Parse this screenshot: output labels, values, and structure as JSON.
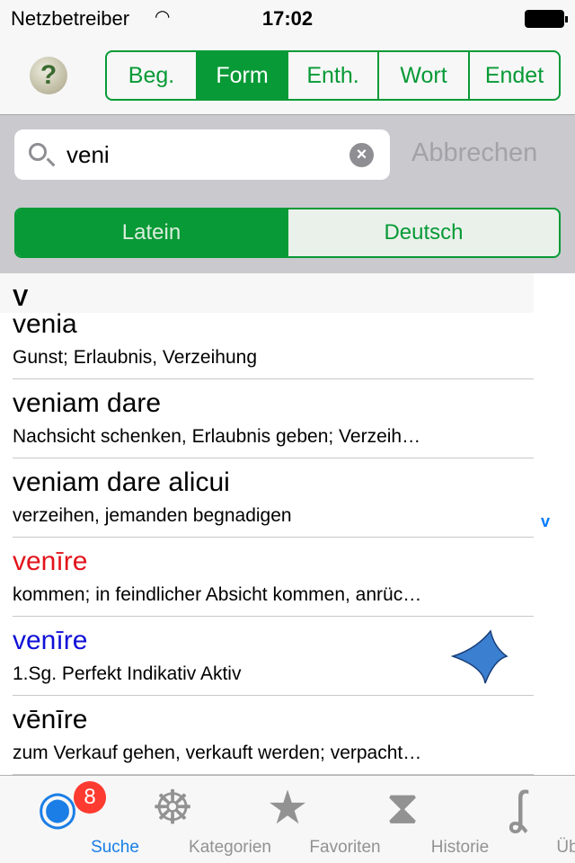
{
  "status": {
    "carrier": "Netzbetreiber",
    "time": "17:02"
  },
  "nav": {
    "help_label": "?",
    "modes": [
      {
        "label": "Beg.",
        "selected": false
      },
      {
        "label": "Form",
        "selected": true
      },
      {
        "label": "Enth.",
        "selected": false
      },
      {
        "label": "Wort",
        "selected": false
      },
      {
        "label": "Endet",
        "selected": false
      }
    ]
  },
  "search": {
    "value": "veni",
    "cancel_label": "Abbrechen"
  },
  "language": {
    "options": [
      "Latein",
      "Deutsch"
    ],
    "selected": "Latein"
  },
  "list": {
    "section": "V",
    "index_letter": "v",
    "rows": [
      {
        "title": "venia",
        "subtitle": "Gunst; Erlaubnis, Verzeihung",
        "color": "#000000"
      },
      {
        "title": "veniam dare",
        "subtitle": "Nachsicht schenken, Erlaubnis geben; Verzeih…",
        "color": "#000000"
      },
      {
        "title": "veniam dare alicui",
        "subtitle": "verzeihen, jemanden begnadigen",
        "color": "#000000"
      },
      {
        "title": "venīre",
        "subtitle": "kommen; in feindlicher Absicht kommen, anrüc…",
        "color": "#e3131b"
      },
      {
        "title": "venīre",
        "subtitle": "1.Sg. Perfekt Indikativ Aktiv",
        "color": "#1010d8"
      },
      {
        "title": "vēnīre",
        "subtitle": "zum Verkauf gehen, verkauft werden; verpacht…",
        "color": "#000000"
      }
    ]
  },
  "colors": {
    "accent": "#079a36",
    "tab_active": "#1a7ee6",
    "badge": "#fe3b30"
  },
  "tabs": [
    {
      "label": "Suche",
      "icon": "search-creature-icon",
      "badge": "8",
      "active": true
    },
    {
      "label": "Kategorien",
      "icon": "octopus-icon"
    },
    {
      "label": "Favoriten",
      "icon": "starfish-icon"
    },
    {
      "label": "Historie",
      "icon": "hourglass-icon"
    },
    {
      "label": "Über",
      "icon": "seahorse-icon"
    }
  ]
}
